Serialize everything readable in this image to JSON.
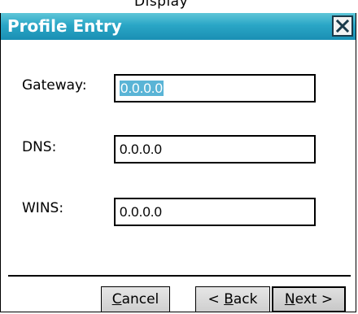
{
  "window": {
    "clipped_text": "Display",
    "title": "Profile Entry",
    "close_icon": "close-icon"
  },
  "fields": {
    "gateway": {
      "label": "Gateway:",
      "value": "0.0.0.0"
    },
    "dns": {
      "label": "DNS:",
      "value": "0.0.0.0"
    },
    "wins": {
      "label": "WINS:",
      "value": "0.0.0.0"
    }
  },
  "buttons": {
    "cancel": {
      "underlined": "C",
      "rest": "ancel"
    },
    "back": {
      "prefix": "< ",
      "underlined": "B",
      "rest": "ack"
    },
    "next": {
      "underlined": "N",
      "rest": "ext >"
    }
  },
  "colors": {
    "title_bar": "#2aa6c6",
    "selection": "#5ab4d6"
  }
}
